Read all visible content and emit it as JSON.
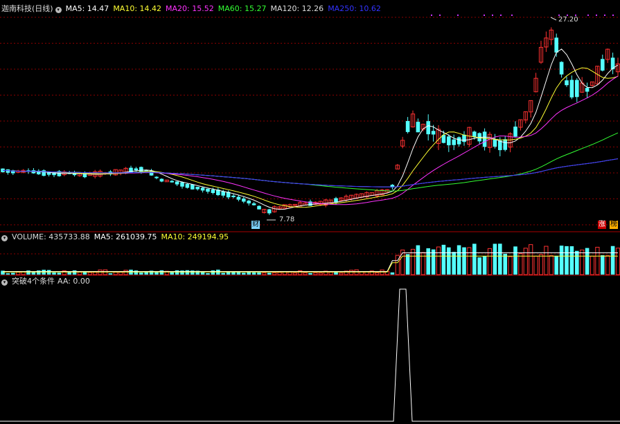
{
  "main_panel": {
    "title": "迦南科技(日线)",
    "ma_labels": [
      {
        "text": "MA5: 14.47",
        "color": "#ffffff"
      },
      {
        "text": "MA10: 14.42",
        "color": "#ffff33"
      },
      {
        "text": "MA20: 15.52",
        "color": "#ff33ff"
      },
      {
        "text": "MA60: 15.27",
        "color": "#33ff33"
      },
      {
        "text": "MA120: 12.26",
        "color": "#dddddd"
      },
      {
        "text": "MA250: 10.62",
        "color": "#3333ff"
      }
    ],
    "high_label": "27.20",
    "low_label": "7.78",
    "badge_cai": "财",
    "badge_zhang": "涨",
    "badge_bang": "榜"
  },
  "volume_panel": {
    "title": "VOLUME: 435733.88",
    "ma5_label": "MA5: 261039.75",
    "ma10_label": "MA10: 249194.95"
  },
  "indicator_panel": {
    "title": "突破4个条件",
    "value_label": "AA: 0.00"
  },
  "colors": {
    "up": "#ff3232",
    "down": "#54ffff",
    "grid": "#8b0000",
    "border": "#aa0000"
  },
  "chart_data": [
    {
      "type": "candlestick",
      "title": "迦南科技(日线)",
      "ylim": [
        7,
        28
      ],
      "annotated_high": 27.2,
      "annotated_low": 7.78,
      "price_path": [
        [
          0,
          12.2
        ],
        [
          20,
          12.0
        ],
        [
          40,
          12.1
        ],
        [
          60,
          11.9
        ],
        [
          80,
          11.8
        ],
        [
          100,
          11.9
        ],
        [
          120,
          11.7
        ],
        [
          140,
          11.8
        ],
        [
          160,
          11.9
        ],
        [
          180,
          12.1
        ],
        [
          200,
          12.3
        ],
        [
          215,
          12.1
        ],
        [
          230,
          11.2
        ],
        [
          250,
          11.0
        ],
        [
          270,
          10.6
        ],
        [
          290,
          10.3
        ],
        [
          310,
          10.0
        ],
        [
          330,
          9.7
        ],
        [
          350,
          9.2
        ],
        [
          365,
          8.8
        ],
        [
          378,
          8.2
        ],
        [
          385,
          7.9
        ],
        [
          395,
          8.2
        ],
        [
          410,
          8.5
        ],
        [
          430,
          8.7
        ],
        [
          450,
          8.8
        ],
        [
          470,
          8.9
        ],
        [
          490,
          9.2
        ],
        [
          510,
          9.5
        ],
        [
          530,
          9.7
        ],
        [
          550,
          9.9
        ],
        [
          565,
          10.2
        ],
        [
          575,
          12.8
        ],
        [
          585,
          16.2
        ],
        [
          595,
          17.3
        ],
        [
          605,
          16.4
        ],
        [
          615,
          16.7
        ],
        [
          625,
          16.0
        ],
        [
          635,
          15.5
        ],
        [
          645,
          15.2
        ],
        [
          655,
          15.0
        ],
        [
          665,
          15.2
        ],
        [
          675,
          15.6
        ],
        [
          685,
          15.8
        ],
        [
          695,
          15.4
        ],
        [
          705,
          15.2
        ],
        [
          715,
          14.9
        ],
        [
          725,
          14.6
        ],
        [
          735,
          15.0
        ],
        [
          745,
          16.2
        ],
        [
          755,
          17.3
        ],
        [
          765,
          18.3
        ],
        [
          775,
          21.2
        ],
        [
          782,
          24.3
        ],
        [
          790,
          25.3
        ],
        [
          797,
          26.0
        ],
        [
          805,
          24.5
        ],
        [
          812,
          22.0
        ],
        [
          820,
          20.7
        ],
        [
          828,
          20.3
        ],
        [
          838,
          20.6
        ],
        [
          848,
          20.3
        ],
        [
          858,
          21.2
        ],
        [
          866,
          22.3
        ],
        [
          873,
          23.3
        ],
        [
          880,
          24.3
        ],
        [
          888,
          22.0
        ],
        [
          894,
          22.8
        ]
      ],
      "ma_values_last": {
        "MA5": 14.47,
        "MA10": 14.42,
        "MA20": 15.52,
        "MA60": 15.27,
        "MA120": 12.26,
        "MA250": 10.62
      }
    },
    {
      "type": "bar",
      "title": "VOLUME",
      "last_value": 435733.88,
      "ma5": 261039.75,
      "ma10": 249194.95
    },
    {
      "type": "line",
      "title": "突破4个条件",
      "series": [
        {
          "name": "AA",
          "last_value": 0.0
        }
      ],
      "signal_spike": {
        "value": 1
      }
    }
  ]
}
